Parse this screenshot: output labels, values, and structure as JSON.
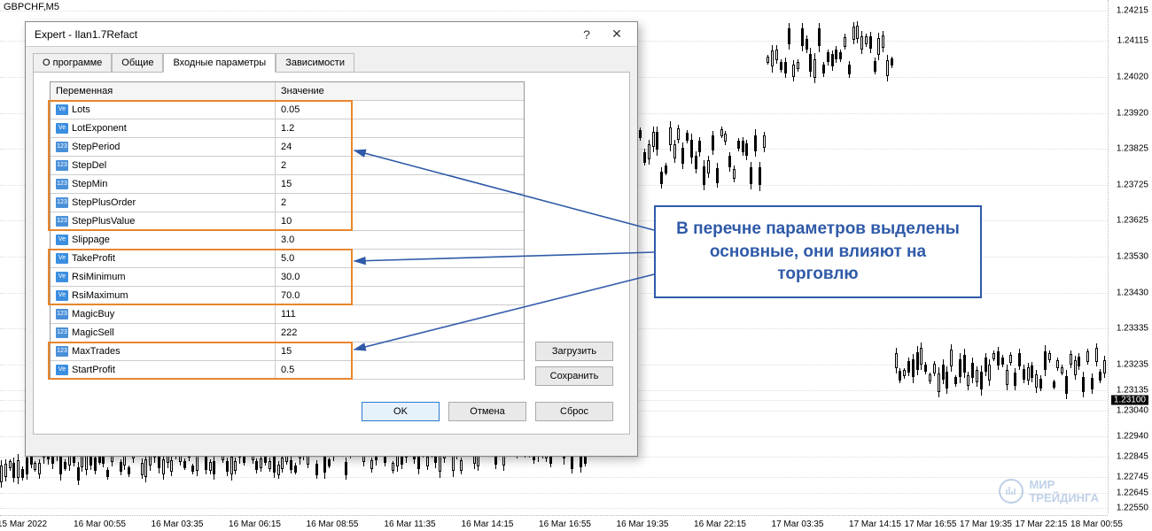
{
  "chart": {
    "symbol": "GBPCHF,M5",
    "price_ticks": [
      {
        "v": "1.24215",
        "p": 2
      },
      {
        "v": "1.24115",
        "p": 8
      },
      {
        "v": "1.24020",
        "p": 15
      },
      {
        "v": "1.23920",
        "p": 22
      },
      {
        "v": "1.23825",
        "p": 29
      },
      {
        "v": "1.23725",
        "p": 36
      },
      {
        "v": "1.23625",
        "p": 43
      },
      {
        "v": "1.23530",
        "p": 50
      },
      {
        "v": "1.23430",
        "p": 57
      },
      {
        "v": "1.23335",
        "p": 64
      },
      {
        "v": "1.23235",
        "p": 71
      },
      {
        "v": "1.23135",
        "p": 76
      },
      {
        "v": "1.23100",
        "p": 78,
        "current": true
      },
      {
        "v": "1.23040",
        "p": 80
      },
      {
        "v": "1.22940",
        "p": 85
      },
      {
        "v": "1.22845",
        "p": 89
      },
      {
        "v": "1.22745",
        "p": 93
      },
      {
        "v": "1.22645",
        "p": 96
      },
      {
        "v": "1.22550",
        "p": 99
      }
    ],
    "time_ticks": [
      {
        "v": "15 Mar 2022",
        "p": 2
      },
      {
        "v": "16 Mar 00:55",
        "p": 9
      },
      {
        "v": "16 Mar 03:35",
        "p": 16
      },
      {
        "v": "16 Mar 06:15",
        "p": 23
      },
      {
        "v": "16 Mar 08:55",
        "p": 30
      },
      {
        "v": "16 Mar 11:35",
        "p": 37
      },
      {
        "v": "16 Mar 14:15",
        "p": 44
      },
      {
        "v": "16 Mar 16:55",
        "p": 51
      },
      {
        "v": "16 Mar 19:35",
        "p": 58
      },
      {
        "v": "16 Mar 22:15",
        "p": 65
      },
      {
        "v": "17 Mar 03:35",
        "p": 72
      },
      {
        "v": "17 Mar 14:15",
        "p": 79
      },
      {
        "v": "17 Mar 16:55",
        "p": 84
      },
      {
        "v": "17 Mar 19:35",
        "p": 89
      },
      {
        "v": "17 Mar 22:15",
        "p": 94
      },
      {
        "v": "18 Mar 00:55",
        "p": 99
      }
    ]
  },
  "dialog": {
    "title": "Expert - Ilan1.7Refact",
    "help": "?",
    "close": "✕",
    "tabs": [
      "О программе",
      "Общие",
      "Входные параметры",
      "Зависимости"
    ],
    "active_tab": 2,
    "columns": {
      "var": "Переменная",
      "val": "Значение"
    },
    "rows": [
      {
        "icon": "Ve",
        "name": "Lots",
        "val": "0.05"
      },
      {
        "icon": "Ve",
        "name": "LotExponent",
        "val": "1.2"
      },
      {
        "icon": "123",
        "name": "StepPeriod",
        "val": "24"
      },
      {
        "icon": "123",
        "name": "StepDel",
        "val": "2"
      },
      {
        "icon": "123",
        "name": "StepMin",
        "val": "15"
      },
      {
        "icon": "123",
        "name": "StepPlusOrder",
        "val": "2"
      },
      {
        "icon": "123",
        "name": "StepPlusValue",
        "val": "10"
      },
      {
        "icon": "Ve",
        "name": "Slippage",
        "val": "3.0"
      },
      {
        "icon": "Ve",
        "name": "TakeProfit",
        "val": "5.0"
      },
      {
        "icon": "Ve",
        "name": "RsiMinimum",
        "val": "30.0"
      },
      {
        "icon": "Ve",
        "name": "RsiMaximum",
        "val": "70.0"
      },
      {
        "icon": "123",
        "name": "MagicBuy",
        "val": "111"
      },
      {
        "icon": "123",
        "name": "MagicSell",
        "val": "222"
      },
      {
        "icon": "123",
        "name": "MaxTrades",
        "val": "15"
      },
      {
        "icon": "Ve",
        "name": "StartProfit",
        "val": "0.5"
      }
    ],
    "side_buttons": {
      "load": "Загрузить",
      "save": "Сохранить"
    },
    "buttons": {
      "ok": "OK",
      "cancel": "Отмена",
      "reset": "Сброс"
    }
  },
  "callout": {
    "text": "В перечне параметров выделены основные, они влияют на торговлю"
  },
  "watermark": {
    "line1": "МИР",
    "line2": "ТРЕЙДИНГА"
  }
}
